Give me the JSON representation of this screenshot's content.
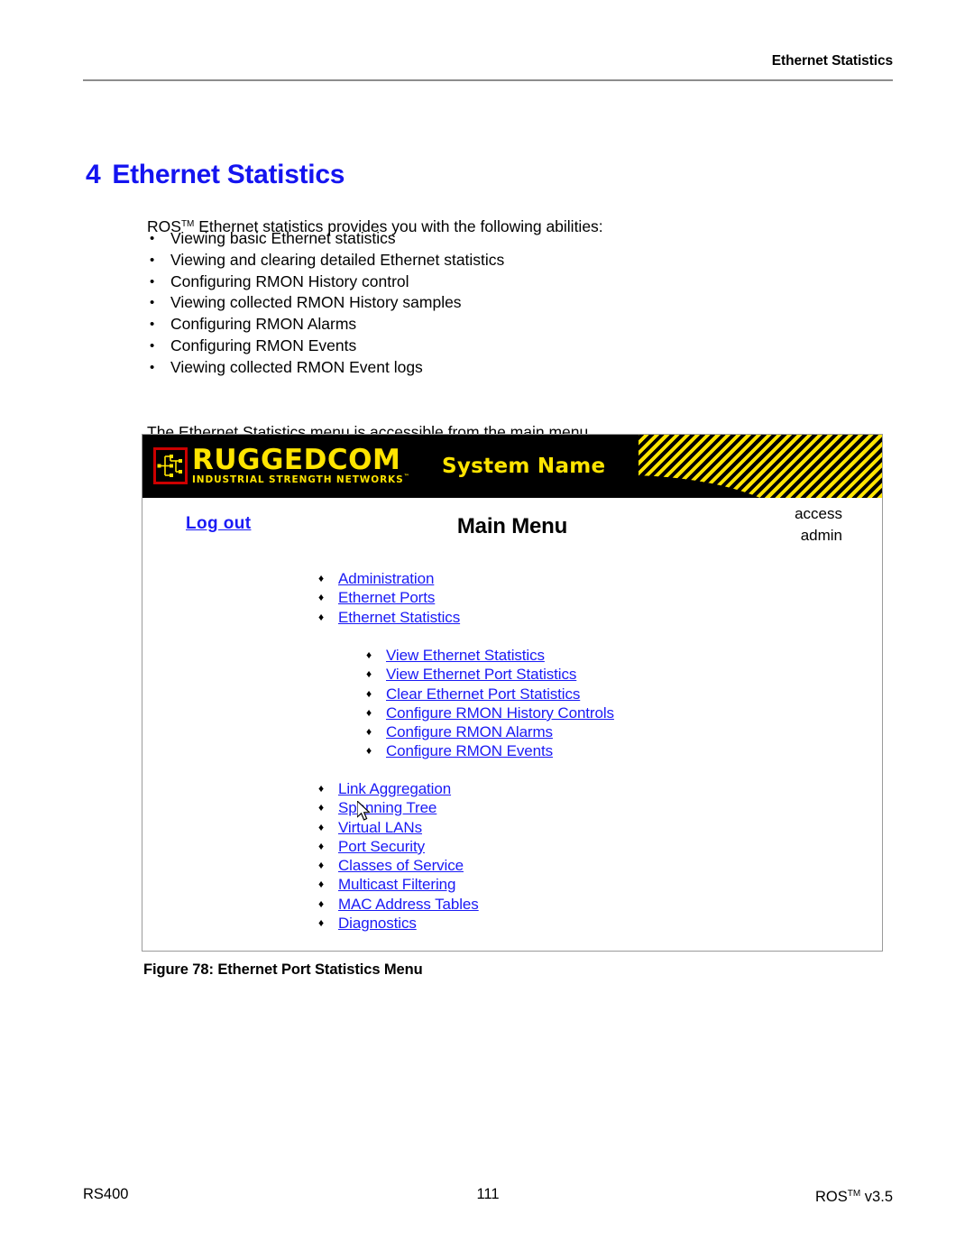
{
  "header": {
    "running_title": "Ethernet Statistics"
  },
  "chapter": {
    "number": "4",
    "title": "Ethernet Statistics"
  },
  "intro": {
    "before_tm": "ROS",
    "tm": "TM",
    "after_tm": " Ethernet statistics provides you with the following abilities:",
    "bullet_glyph": "•",
    "items": [
      "Viewing basic Ethernet statistics",
      "Viewing and clearing detailed Ethernet statistics",
      "Configuring RMON History control",
      "Viewing collected RMON History samples",
      "Configuring RMON Alarms",
      "Configuring RMON Events",
      "Viewing collected RMON Event logs"
    ]
  },
  "menu_para": "The Ethernet Statistics menu is accessible from the main menu.",
  "figure": {
    "caption": "Figure 78: Ethernet Port Statistics Menu",
    "colors": {
      "banner_background": "#000000",
      "logo_yellow": "#ffe400",
      "logo_border_red": "#cc0000",
      "link_blue": "#1a1af5"
    },
    "banner": {
      "logo_word": "RUGGEDCOM",
      "logo_tagline": "INDUSTRIAL STRENGTH NETWORKS",
      "logo_tagline_tm": "™",
      "logo_icon_name": "ruggedcom-network-tree-icon",
      "system_name": "System Name",
      "hazard_stripes_name": "yellow-black-hazard-stripes"
    },
    "toolbar": {
      "logout_label": "Log out",
      "page_title": "Main Menu",
      "access_label": "access",
      "access_user": "admin"
    },
    "diamond_glyph": "♦",
    "menu_group_top": [
      "Administration",
      "Ethernet Ports",
      "Ethernet Statistics"
    ],
    "menu_group_sub": [
      "View Ethernet Statistics",
      "View Ethernet Port Statistics",
      "Clear Ethernet Port Statistics",
      "Configure RMON History Controls",
      "Configure RMON Alarms",
      "Configure RMON Events"
    ],
    "menu_group_bottom": [
      "Link Aggregation",
      "Spanning Tree",
      "Virtual LANs",
      "Port Security",
      "Classes of Service",
      "Multicast Filtering",
      "MAC Address Tables",
      "Diagnostics"
    ]
  },
  "footer": {
    "left": "RS400",
    "center": "111",
    "right_before_tm": "ROS",
    "right_tm": "TM",
    "right_after_tm": " v3.5"
  }
}
